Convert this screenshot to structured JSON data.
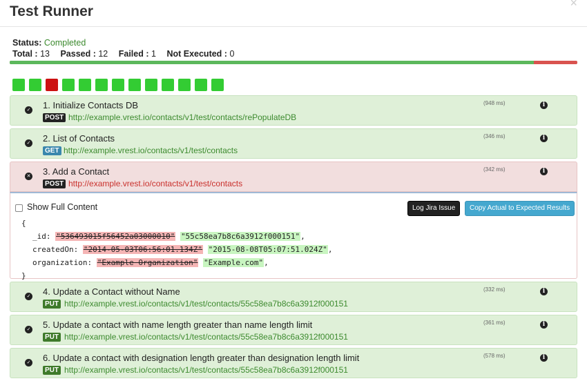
{
  "header": {
    "title": "Test Runner",
    "close": "×"
  },
  "summary": {
    "status_label": "Status:",
    "status_value": "Completed",
    "total_label": "Total :",
    "total_value": "13",
    "passed_label": "Passed :",
    "passed_value": "12",
    "failed_label": "Failed :",
    "failed_value": "1",
    "not_executed_label": "Not Executed :",
    "not_executed_value": "0"
  },
  "progress": {
    "passed_fraction": 0.923,
    "pass_color": "#5cb85c",
    "fail_color": "#d9534f"
  },
  "square_statuses": [
    "pass",
    "pass",
    "fail",
    "pass",
    "pass",
    "pass",
    "pass",
    "pass",
    "pass",
    "pass",
    "pass",
    "pass",
    "pass"
  ],
  "tests": [
    {
      "name": "1. Initialize Contacts DB",
      "method": "POST",
      "url": "http://example.vrest.io/contacts/v1/test/contacts/rePopulateDB",
      "time": "(948 ms)",
      "status": "pass"
    },
    {
      "name": "2. List of Contacts",
      "method": "GET",
      "url": "http://example.vrest.io/contacts/v1/test/contacts",
      "time": "(346 ms)",
      "status": "pass"
    },
    {
      "name": "3. Add a Contact",
      "method": "POST",
      "url": "http://example.vrest.io/contacts/v1/test/contacts",
      "time": "(342 ms)",
      "status": "fail"
    },
    {
      "name": "4. Update a Contact without Name",
      "method": "PUT",
      "url": "http://example.vrest.io/contacts/v1/test/contacts/55c58ea7b8c6a3912f000151",
      "time": "(332 ms)",
      "status": "pass"
    },
    {
      "name": "5. Update a contact with name length greater than name length limit",
      "method": "PUT",
      "url": "http://example.vrest.io/contacts/v1/test/contacts/55c58ea7b8c6a3912f000151",
      "time": "(361 ms)",
      "status": "pass"
    },
    {
      "name": "6. Update a contact with designation length greater than designation length limit",
      "method": "PUT",
      "url": "http://example.vrest.io/contacts/v1/test/contacts/55c58ea7b8c6a3912f000151",
      "time": "(578 ms)",
      "status": "pass"
    }
  ],
  "detail": {
    "show_full_label": "Show Full Content",
    "show_full_checked": false,
    "log_jira_label": "Log Jira Issue",
    "copy_label": "Copy Actual to Expected Results",
    "open_brace": "{",
    "close_brace": "}",
    "diff": [
      {
        "key": "_id:",
        "expected": "\"536493015f56452a03000010\"",
        "actual": "\"55c58ea7b8c6a3912f000151\"",
        "end": ","
      },
      {
        "key": "createdOn:",
        "expected": "\"2014-05-03T06:56:01.134Z\"",
        "actual": "\"2015-08-08T05:07:51.024Z\"",
        "end": ","
      },
      {
        "key": "organization:",
        "expected": "\"Example Organization\"",
        "actual": "\"Example.com\"",
        "end": ","
      }
    ]
  }
}
